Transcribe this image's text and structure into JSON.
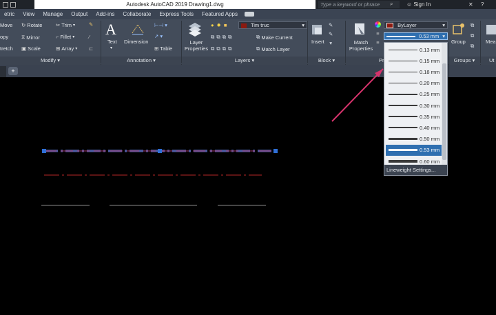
{
  "titlebar": {
    "title": "Autodesk AutoCAD 2019    Drawing1.dwg",
    "search_placeholder": "Type a keyword or phrase",
    "sign_in": "Sign In",
    "help": "?"
  },
  "tabs": [
    "etric",
    "View",
    "Manage",
    "Output",
    "Add-ins",
    "Collaborate",
    "Express Tools",
    "Featured Apps"
  ],
  "ribbon": {
    "modify": {
      "title": "Modify",
      "items": {
        "move": "Move",
        "rotate": "Rotate",
        "trim": "Trim",
        "copy": "opy",
        "mirror": "Mirror",
        "fillet": "Fillet",
        "stretch": "tretch",
        "scale": "Scale",
        "array": "Array"
      }
    },
    "annotation": {
      "title": "Annotation",
      "text": "Text",
      "dimension": "Dimension",
      "table": "Table"
    },
    "layers": {
      "title": "Layers",
      "layer_properties": "Layer Properties",
      "layer_name": "Tim truc",
      "make_current": "Make Current",
      "match_layer": "Match Layer"
    },
    "block": {
      "title": "Block",
      "insert": "Insert"
    },
    "properties": {
      "title": "Pr",
      "match_properties": "Match Properties",
      "color_value": "ByLayer",
      "lineweight_value": "0.53 mm"
    },
    "groups": {
      "title": "Groups",
      "group": "Group"
    },
    "utilities": {
      "title": "Ut",
      "measure": "Mea"
    }
  },
  "lineweight_dropdown": {
    "items": [
      {
        "label": "0.13 mm",
        "weight": 0.13
      },
      {
        "label": "0.15 mm",
        "weight": 0.15
      },
      {
        "label": "0.18 mm",
        "weight": 0.18
      },
      {
        "label": "0.20 mm",
        "weight": 0.2
      },
      {
        "label": "0.25 mm",
        "weight": 0.25
      },
      {
        "label": "0.30 mm",
        "weight": 0.3
      },
      {
        "label": "0.35 mm",
        "weight": 0.35
      },
      {
        "label": "0.40 mm",
        "weight": 0.4
      },
      {
        "label": "0.50 mm",
        "weight": 0.5
      },
      {
        "label": "0.53 mm",
        "weight": 0.53,
        "selected": true
      },
      {
        "label": "0.60 mm",
        "weight": 0.6
      }
    ],
    "footer": "Lineweight Settings..."
  },
  "colors": {
    "ribbon_bg": "#434c5a",
    "layer_color": "#8b1a10",
    "selection": "#2f6fb0",
    "arrow": "#d6336c",
    "grip": "#2f6fd6"
  }
}
